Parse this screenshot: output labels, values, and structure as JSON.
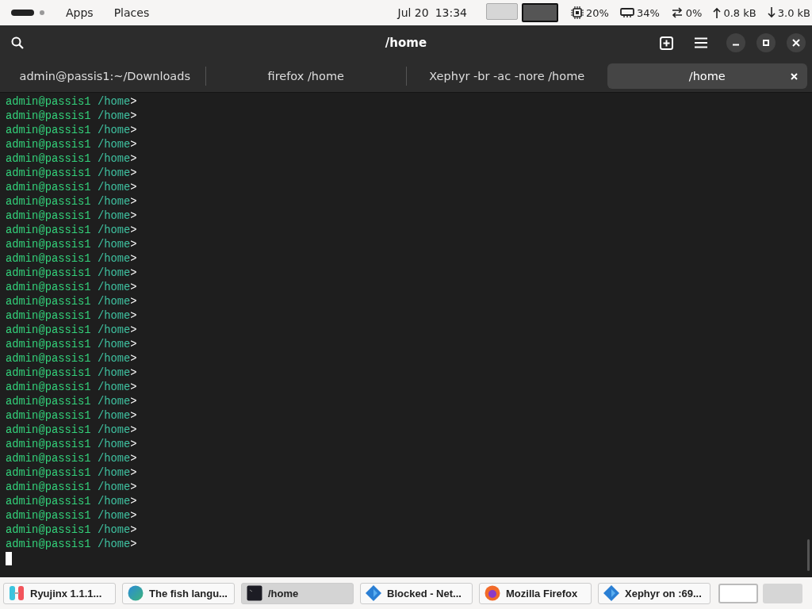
{
  "top_panel": {
    "apps": "Apps",
    "places": "Places",
    "date": "Jul 20",
    "time": "13:34",
    "workspaces": [
      {
        "selected": false
      },
      {
        "selected": true
      }
    ],
    "indicators": [
      {
        "kind": "cpu",
        "value": "20%"
      },
      {
        "kind": "memory",
        "value": "34%"
      },
      {
        "kind": "swap",
        "value": "0%"
      },
      {
        "kind": "upload",
        "value": "0.8 kB"
      },
      {
        "kind": "download",
        "value": "3.0 kB"
      }
    ]
  },
  "window": {
    "title": "/home"
  },
  "tabs": [
    {
      "label": "admin@passis1:~/Downloads",
      "selected": false
    },
    {
      "label": "firefox /home",
      "selected": false
    },
    {
      "label": "Xephyr -br -ac -nore /home",
      "selected": false
    },
    {
      "label": "/home",
      "selected": true
    }
  ],
  "terminal": {
    "lines": [
      {
        "user": "admin@passis1",
        "path": "/home",
        "symbol": ">"
      },
      {
        "user": "admin@passis1",
        "path": "/home",
        "symbol": ">"
      },
      {
        "user": "admin@passis1",
        "path": "/home",
        "symbol": ">"
      },
      {
        "user": "admin@passis1",
        "path": "/home",
        "symbol": ">"
      },
      {
        "user": "admin@passis1",
        "path": "/home",
        "symbol": ">"
      },
      {
        "user": "admin@passis1",
        "path": "/home",
        "symbol": ">"
      },
      {
        "user": "admin@passis1",
        "path": "/home",
        "symbol": ">"
      },
      {
        "user": "admin@passis1",
        "path": "/home",
        "symbol": ">"
      },
      {
        "user": "admin@passis1",
        "path": "/home",
        "symbol": ">"
      },
      {
        "user": "admin@passis1",
        "path": "/home",
        "symbol": ">"
      },
      {
        "user": "admin@passis1",
        "path": "/home",
        "symbol": ">"
      },
      {
        "user": "admin@passis1",
        "path": "/home",
        "symbol": ">"
      },
      {
        "user": "admin@passis1",
        "path": "/home",
        "symbol": ">"
      },
      {
        "user": "admin@passis1",
        "path": "/home",
        "symbol": ">"
      },
      {
        "user": "admin@passis1",
        "path": "/home",
        "symbol": ">"
      },
      {
        "user": "admin@passis1",
        "path": "/home",
        "symbol": ">"
      },
      {
        "user": "admin@passis1",
        "path": "/home",
        "symbol": ">"
      },
      {
        "user": "admin@passis1",
        "path": "/home",
        "symbol": ">"
      },
      {
        "user": "admin@passis1",
        "path": "/home",
        "symbol": ">"
      },
      {
        "user": "admin@passis1",
        "path": "/home",
        "symbol": ">"
      },
      {
        "user": "admin@passis1",
        "path": "/home",
        "symbol": ">"
      },
      {
        "user": "admin@passis1",
        "path": "/home",
        "symbol": ">"
      },
      {
        "user": "admin@passis1",
        "path": "/home",
        "symbol": ">"
      },
      {
        "user": "admin@passis1",
        "path": "/home",
        "symbol": ">"
      },
      {
        "user": "admin@passis1",
        "path": "/home",
        "symbol": ">"
      },
      {
        "user": "admin@passis1",
        "path": "/home",
        "symbol": ">"
      },
      {
        "user": "admin@passis1",
        "path": "/home",
        "symbol": ">"
      },
      {
        "user": "admin@passis1",
        "path": "/home",
        "symbol": ">"
      },
      {
        "user": "admin@passis1",
        "path": "/home",
        "symbol": ">"
      },
      {
        "user": "admin@passis1",
        "path": "/home",
        "symbol": ">"
      },
      {
        "user": "admin@passis1",
        "path": "/home",
        "symbol": ">"
      },
      {
        "user": "admin@passis1",
        "path": "/home",
        "symbol": ">"
      }
    ]
  },
  "taskbar": {
    "items": [
      {
        "kind": "ryujinx",
        "label": "Ryujinx 1.1.1...",
        "selected": false
      },
      {
        "kind": "globe",
        "label": "The fish langu...",
        "selected": false
      },
      {
        "kind": "terminal",
        "label": "/home",
        "selected": true
      },
      {
        "kind": "diamond",
        "label": "Blocked - Net...",
        "selected": false
      },
      {
        "kind": "firefox",
        "label": "Mozilla Firefox",
        "selected": false
      },
      {
        "kind": "diamond",
        "label": "Xephyr on :69...",
        "selected": false
      }
    ],
    "workspaces": [
      {
        "selected": true
      },
      {
        "selected": false
      }
    ]
  }
}
